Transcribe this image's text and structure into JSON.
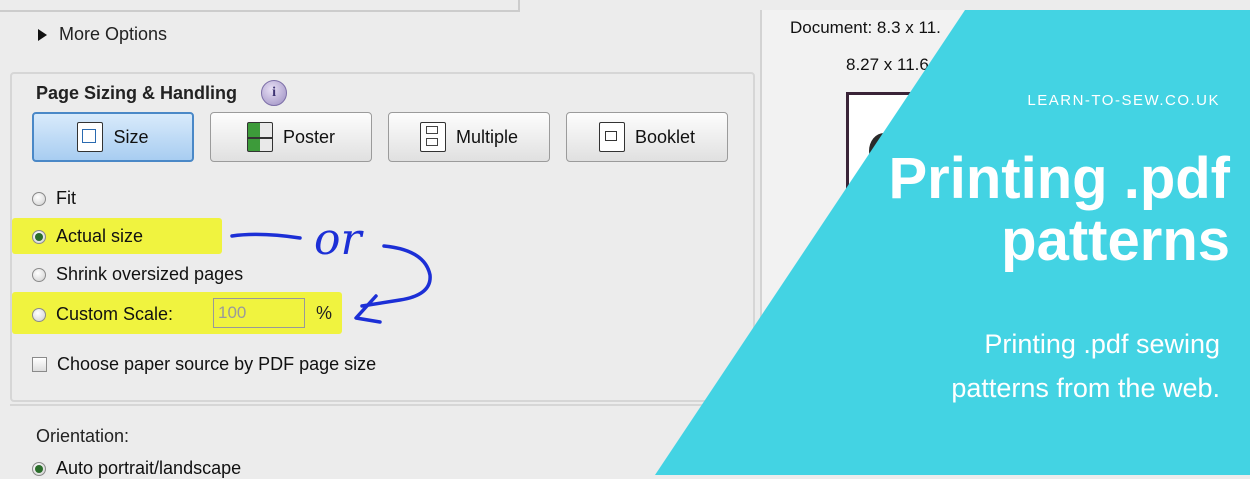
{
  "more_options": "More Options",
  "section": {
    "title": "Page Sizing & Handling",
    "info_icon": "info-icon"
  },
  "buttons": [
    {
      "label": "Size",
      "icon": "size-icon",
      "active": true
    },
    {
      "label": "Poster",
      "icon": "poster-icon",
      "active": false
    },
    {
      "label": "Multiple",
      "icon": "multiple-icon",
      "active": false
    },
    {
      "label": "Booklet",
      "icon": "booklet-icon",
      "active": false
    }
  ],
  "sizing_options": {
    "fit": "Fit",
    "actual_size": "Actual size",
    "shrink": "Shrink oversized pages",
    "custom_scale": "Custom Scale:",
    "selected": "actual_size"
  },
  "custom_scale_value": "100",
  "percent_sign": "%",
  "paper_source": {
    "label": "Choose paper source by PDF page size",
    "checked": false
  },
  "orientation": {
    "label": "Orientation:",
    "selected_option": "Auto portrait/landscape"
  },
  "preview": {
    "document_size": "Document: 8.3 x 11.",
    "page_size": "8.27 x 11.6"
  },
  "annotation": {
    "handwritten": "or",
    "highlight_color": "#f0f330",
    "ink_color": "#1c2fd6"
  },
  "banner": {
    "site": "LEARN-TO-SEW.CO.UK",
    "headline_line1": "Printing .pdf",
    "headline_line2": "patterns",
    "sub_line1": "Printing .pdf sewing",
    "sub_line2": "patterns from the web.",
    "color": "#43d3e3"
  }
}
